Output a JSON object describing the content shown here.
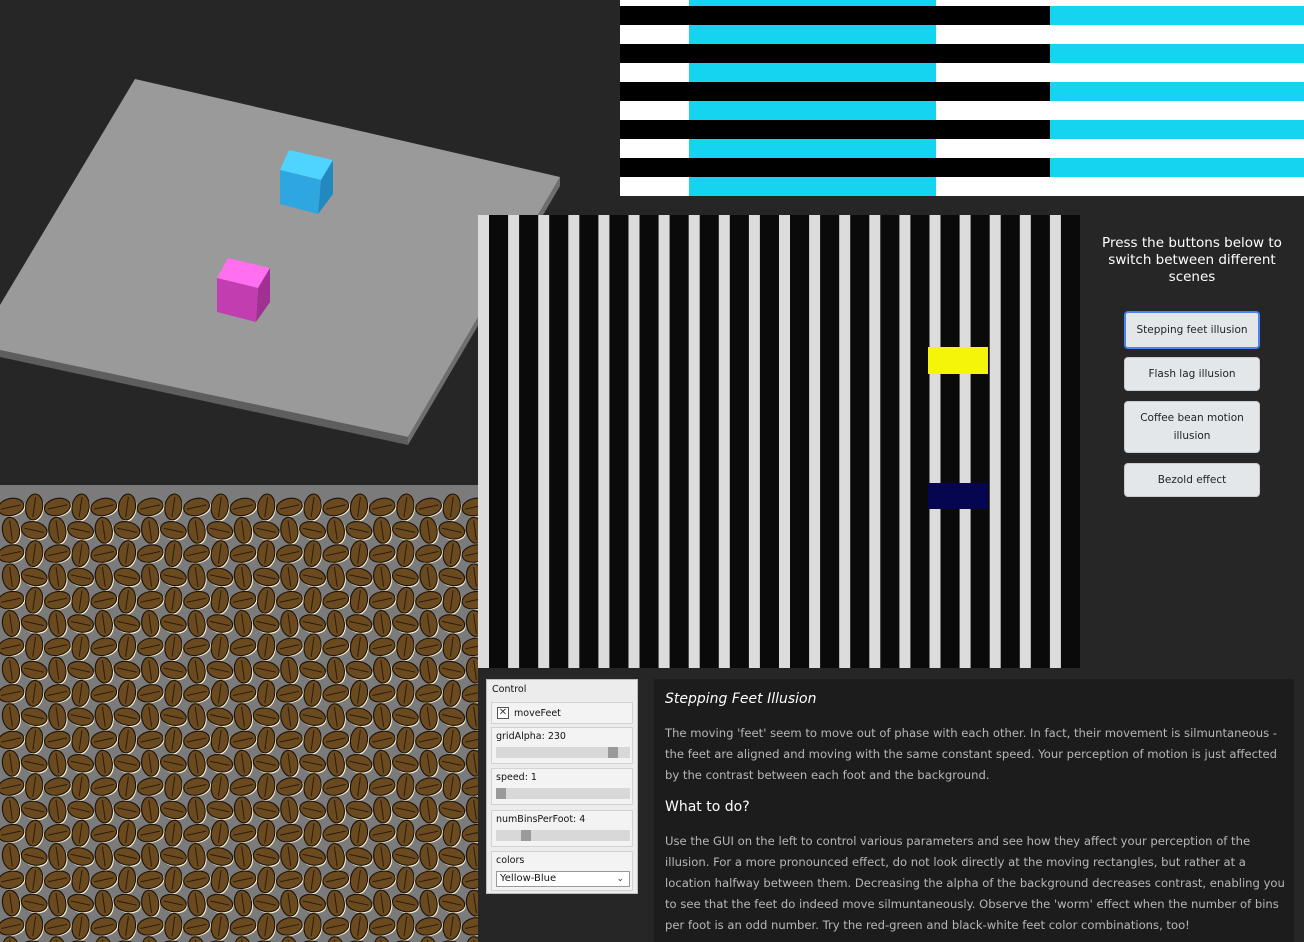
{
  "sidebar": {
    "instruction": "Press the buttons below to switch between different scenes",
    "buttons": [
      {
        "label": "Stepping feet illusion",
        "active": true
      },
      {
        "label": "Flash lag illusion",
        "active": false
      },
      {
        "label": "Coffee bean motion illusion",
        "active": false
      },
      {
        "label": "Bezold effect",
        "active": false
      }
    ]
  },
  "gui": {
    "title": "Control",
    "move_feet_label": "moveFeet",
    "move_feet_checked": true,
    "grid_alpha_label": "gridAlpha: 230",
    "grid_alpha_fraction": 0.9,
    "speed_label": "speed: 1",
    "speed_fraction": 0.0,
    "num_bins_label": "numBinsPerFoot: 4",
    "num_bins_fraction": 0.2,
    "colors_label": "colors",
    "colors_selected": "Yellow-Blue"
  },
  "description": {
    "title": "Stepping Feet Illusion",
    "paragraph1": "The moving 'feet' seem to move out of phase with each other. In fact, their movement is silmuntaneous - the feet are aligned and moving with the same constant speed. Your perception of motion is just affected by the contrast between each foot and the background.",
    "subheading": "What to do?",
    "paragraph2": "Use the GUI on the left to control various parameters and see how they affect your perception of the illusion. For a more pronounced effect, do not look directly at the moving rectangles, but rather at a location halfway between them. Decreasing the alpha of the background decreases contrast, enabling you to see that the feet do indeed move silmuntaneously. Observe the 'worm' effect when the number of bins per foot is an odd number. Try the red-green and black-white feet color combinations, too!"
  },
  "colors": {
    "background": "#262626",
    "cyan": "#15d4f0",
    "foot_yellow": "#f5f50a",
    "foot_blue": "#050550",
    "cube_blue": "#2ea6e0",
    "cube_pink": "#e040c8",
    "button_active_border": "#4a82ee"
  }
}
